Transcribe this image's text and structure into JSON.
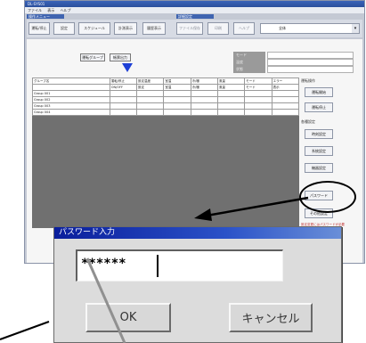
{
  "window": {
    "title": "DL-SYS01",
    "menu": [
      "ファイル",
      "表示",
      "ヘルプ"
    ]
  },
  "groups": {
    "left_label": "操作メニュー",
    "right_label": "詳細設定"
  },
  "toolbar": {
    "buttons": [
      "運転/停止",
      "設定",
      "スケジュール",
      "計測表示",
      "履歴表示",
      "ファイル保存",
      "印刷",
      "ヘルプ"
    ],
    "combo_value": "全体"
  },
  "panel": {
    "tab_buttons": [
      "運転グループ",
      "帳票出力"
    ],
    "status_labels": [
      "モード",
      "温度",
      "状態"
    ],
    "table_headers": [
      "グループ名",
      "運転/停止",
      "設定温度",
      "室温",
      "冷/暖",
      "風量",
      "モード",
      "エラー"
    ],
    "table_subheaders": [
      "ON/OFF",
      "設定",
      "室温",
      "冷/暖",
      "風量",
      "モード",
      "表示"
    ],
    "table_rows": [
      "Group 001",
      "Group 002",
      "Group 003",
      "Group 004"
    ]
  },
  "sidebar": {
    "section1_label": "運転操作",
    "section1_buttons": [
      "運転開始",
      "運転停止"
    ],
    "section2_label": "各種設定",
    "section2_buttons": [
      "時刻設定",
      "系統設定",
      "機器設定",
      "パスワード",
      "その他設定"
    ],
    "note": "設定変更にはパスワードが必要です"
  },
  "dialog": {
    "title": "パスワード入力",
    "password_value": "******",
    "ok_label": "OK",
    "cancel_label": "キャンセル"
  }
}
